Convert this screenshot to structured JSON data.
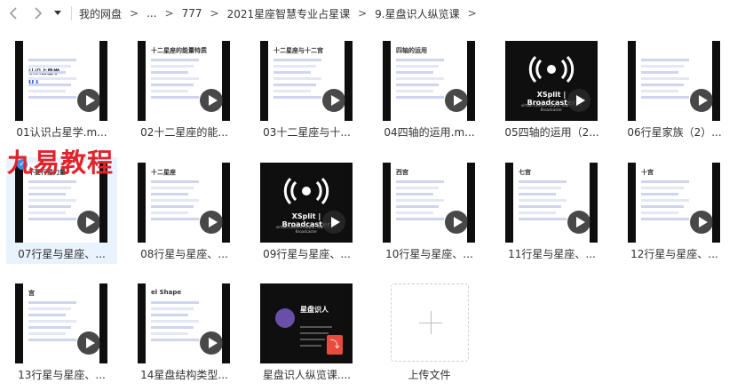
{
  "toolbar": {
    "back_icon": "chevron-left-icon",
    "forward_icon": "chevron-right-icon",
    "dropdown_icon": "caret-down-icon"
  },
  "breadcrumb": [
    {
      "label": "我的网盘"
    },
    {
      "label": "..."
    },
    {
      "label": "777"
    },
    {
      "label": "2021星座智慧专业占星课"
    },
    {
      "label": "9.星盘识人纵览课"
    }
  ],
  "breadcrumb_separator": ">",
  "files": [
    {
      "label": "01认识占星学.m...",
      "kind": "video",
      "thumb_title": "认识占星学",
      "thumb_num": "01"
    },
    {
      "label": "02十二星座的能...",
      "kind": "video",
      "thumb_title": "十二星座的能量特质"
    },
    {
      "label": "03十二星座与十...",
      "kind": "video",
      "thumb_title": "十二星座与十二宫"
    },
    {
      "label": "04四轴的运用.m...",
      "kind": "video",
      "thumb_title": "四轴的运用"
    },
    {
      "label": "05四轴的运用（2...",
      "kind": "video",
      "thumb_title": "XSplit | Broadcaster",
      "thumb_sub": "virtual camera output, start XSplit Broadcaster"
    },
    {
      "label": "06行星家族（2）...",
      "kind": "video",
      "thumb_title": ""
    },
    {
      "label": "07行星与星座、...",
      "kind": "video",
      "thumb_title": "不要行星力量",
      "selected": true
    },
    {
      "label": "08行星与星座、...",
      "kind": "video",
      "thumb_title": "十二星座"
    },
    {
      "label": "09行星与星座、...",
      "kind": "video",
      "thumb_title": "XSplit | Broadcaster",
      "thumb_sub": "virtual camera output, start XSplit Broadcaster"
    },
    {
      "label": "10行星与星座、...",
      "kind": "video",
      "thumb_title": "西宫"
    },
    {
      "label": "11行星与星座、...",
      "kind": "video",
      "thumb_title": "七宫"
    },
    {
      "label": "12行星与星座、...",
      "kind": "video",
      "thumb_title": "十宫"
    },
    {
      "label": "13行星与星座、...",
      "kind": "video",
      "thumb_title": "宫"
    },
    {
      "label": "14星盘结构类型...",
      "kind": "video",
      "thumb_title": "el Shape"
    },
    {
      "label": "星盘识人纵览课....",
      "kind": "pdf",
      "thumb_title": "星盘识人"
    },
    {
      "label": "上传文件",
      "kind": "upload"
    }
  ],
  "watermark": "九易教程",
  "colors": {
    "selection": "#e9f3fe",
    "accent": "#3b8cf0",
    "watermark": "#e0242b",
    "pdf": "#e94b3c"
  }
}
